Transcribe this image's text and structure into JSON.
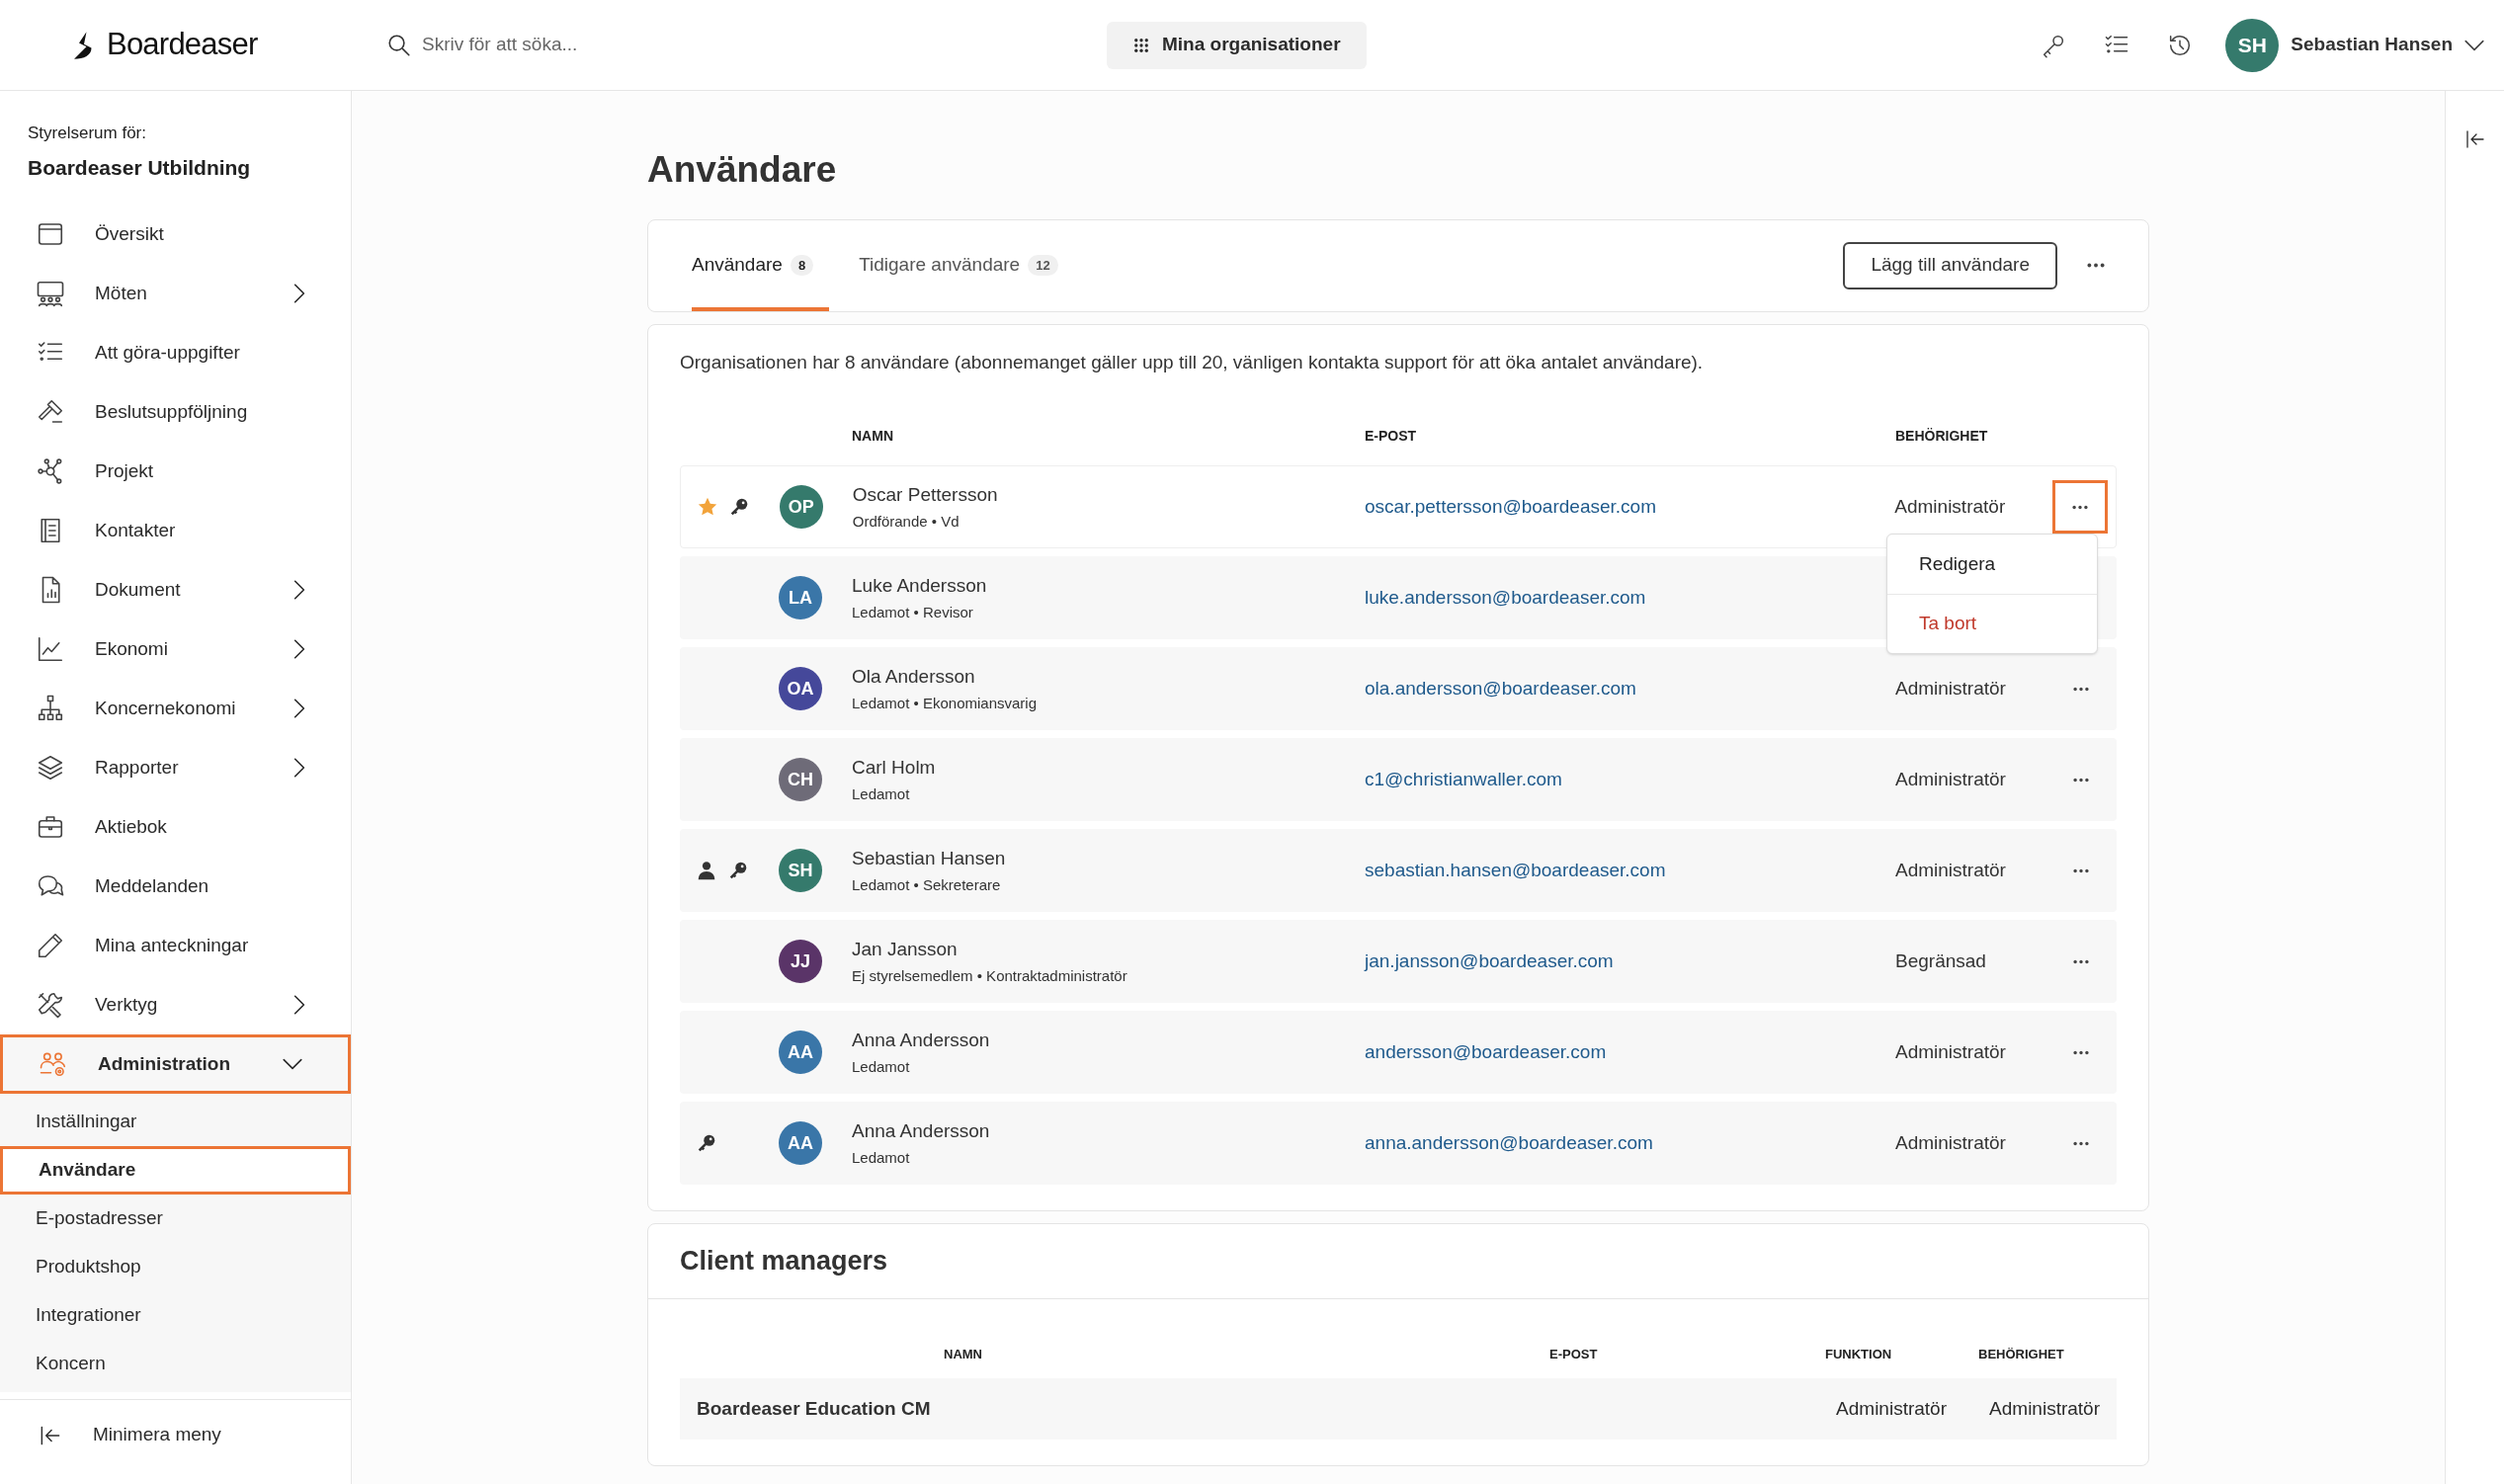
{
  "header": {
    "logo": "Boardeaser",
    "search": {
      "placeholder": "Skriv för att söka..."
    },
    "org_button": "Mina organisationer",
    "user": {
      "initials": "SH",
      "name": "Sebastian Hansen"
    }
  },
  "sidebar": {
    "org_label": "Styrelserum för:",
    "org_name": "Boardeaser Utbildning",
    "items": [
      {
        "kind": "window",
        "label": "Översikt",
        "chevron": false,
        "selected": false
      },
      {
        "kind": "meeting",
        "label": "Möten",
        "chevron": true,
        "selected": false
      },
      {
        "kind": "checklist",
        "label": "Att göra-uppgifter",
        "chevron": false,
        "selected": false
      },
      {
        "kind": "gavel",
        "label": "Beslutsuppföljning",
        "chevron": false,
        "selected": false
      },
      {
        "kind": "network",
        "label": "Projekt",
        "chevron": false,
        "selected": false
      },
      {
        "kind": "book",
        "label": "Kontakter",
        "chevron": false,
        "selected": false
      },
      {
        "kind": "document",
        "label": "Dokument",
        "chevron": true,
        "selected": false
      },
      {
        "kind": "chart",
        "label": "Ekonomi",
        "chevron": true,
        "selected": false
      },
      {
        "kind": "hierarchy",
        "label": "Koncernekonomi",
        "chevron": true,
        "selected": false
      },
      {
        "kind": "layers",
        "label": "Rapporter",
        "chevron": true,
        "selected": false
      },
      {
        "kind": "briefcase",
        "label": "Aktiebok",
        "chevron": false,
        "selected": false
      },
      {
        "kind": "chat",
        "label": "Meddelanden",
        "chevron": false,
        "selected": false
      },
      {
        "kind": "pencil",
        "label": "Mina anteckningar",
        "chevron": false,
        "selected": false
      },
      {
        "kind": "tools",
        "label": "Verktyg",
        "chevron": true,
        "selected": false
      },
      {
        "kind": "admin",
        "label": "Administration",
        "chevron": true,
        "selected": true,
        "expanded": true,
        "children": [
          {
            "label": "Inställningar",
            "selected": false
          },
          {
            "label": "Användare",
            "selected": true
          },
          {
            "label": "E-postadresser",
            "selected": false
          },
          {
            "label": "Produktshop",
            "selected": false
          },
          {
            "label": "Integrationer",
            "selected": false
          },
          {
            "label": "Koncern",
            "selected": false
          }
        ]
      }
    ],
    "collapse": "Minimera meny"
  },
  "page": {
    "title": "Användare",
    "tabs": [
      {
        "label": "Användare",
        "count": "8",
        "selected": true
      },
      {
        "label": "Tidigare användare",
        "count": "12",
        "selected": false
      }
    ],
    "add_button": "Lägg till användare",
    "info": "Organisationen har 8 användare (abonnemanget gäller upp till 20, vänligen kontakta support för att öka antalet användare).",
    "columns": [
      "NAMN",
      "E-POST",
      "BEHÖRIGHET"
    ],
    "users": [
      {
        "initials": "OP",
        "color": "#357a6c",
        "name": "Oscar Pettersson",
        "subtitle": "Ordförande • Vd",
        "email": "oscar.pettersson@boardeaser.com",
        "role": "Administratör",
        "starred": true,
        "current_user": false,
        "has_key": true,
        "menu_open": true
      },
      {
        "initials": "LA",
        "color": "#3a76a8",
        "name": "Luke Andersson",
        "subtitle": "Ledamot • Revisor",
        "email": "luke.andersson@boardeaser.com",
        "starred": false,
        "current_user": false,
        "has_key": false,
        "menu_open": false
      },
      {
        "initials": "OA",
        "color": "#45489a",
        "name": "Ola Andersson",
        "subtitle": "Ledamot • Ekonomiansvarig",
        "email": "ola.andersson@boardeaser.com",
        "role": "Administratör",
        "starred": false,
        "current_user": false,
        "has_key": false,
        "menu_open": false
      },
      {
        "initials": "CH",
        "color": "#6e6b78",
        "name": "Carl Holm",
        "subtitle": "Ledamot",
        "email": "c1@christianwaller.com",
        "role": "Administratör",
        "starred": false,
        "current_user": false,
        "has_key": false,
        "menu_open": false
      },
      {
        "initials": "SH",
        "color": "#357a6c",
        "name": "Sebastian Hansen",
        "subtitle": "Ledamot • Sekreterare",
        "email": "sebastian.hansen@boardeaser.com",
        "role": "Administratör",
        "starred": false,
        "current_user": true,
        "has_key": true,
        "menu_open": false
      },
      {
        "initials": "JJ",
        "color": "#5a3468",
        "name": "Jan Jansson",
        "subtitle": "Ej styrelsemedlem • Kontraktadministratör",
        "email": "jan.jansson@boardeaser.com",
        "role": "Begränsad",
        "starred": false,
        "current_user": false,
        "has_key": false,
        "menu_open": false
      },
      {
        "initials": "AA",
        "color": "#3a76a8",
        "name": "Anna Andersson",
        "subtitle": "Ledamot",
        "email": "andersson@boardeaser.com",
        "role": "Administratör",
        "starred": false,
        "current_user": false,
        "has_key": false,
        "menu_open": false
      },
      {
        "initials": "AA",
        "color": "#3a76a8",
        "name": "Anna Andersson",
        "subtitle": "Ledamot",
        "email": "anna.andersson@boardeaser.com",
        "role": "Administratör",
        "starred": false,
        "current_user": false,
        "has_key": true,
        "menu_open": false
      }
    ],
    "row_menu": [
      {
        "kind": "normal",
        "label": "Redigera"
      },
      {
        "kind": "danger",
        "label": "Ta bort"
      }
    ],
    "client_managers": {
      "title": "Client managers",
      "columns": [
        "NAMN",
        "E-POST",
        "FUNKTION",
        "BEHÖRIGHET"
      ],
      "rows": [
        {
          "name": "Boardeaser Education CM",
          "function": "Administratör",
          "role": "Administratör"
        }
      ]
    }
  }
}
